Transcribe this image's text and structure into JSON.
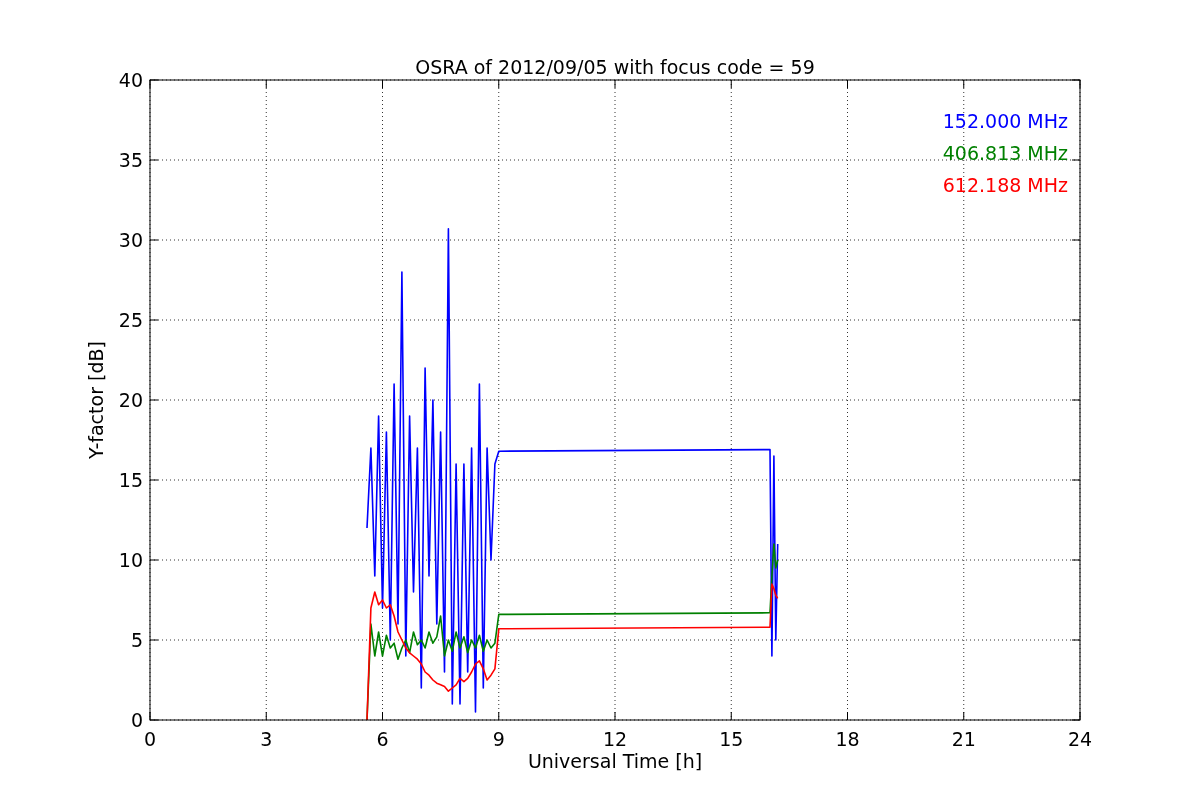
{
  "figure": {
    "chart_data": {
      "type": "line",
      "title": "OSRA of 2012/09/05 with focus code = 59",
      "xlabel": "Universal Time [h]",
      "ylabel": "Y-factor [dB]",
      "grid": true,
      "xlim": [
        0,
        24
      ],
      "ylim": [
        0,
        40
      ],
      "xticks": [
        0,
        3,
        6,
        9,
        12,
        15,
        18,
        21,
        24
      ],
      "yticks": [
        0,
        5,
        10,
        15,
        20,
        25,
        30,
        35,
        40
      ],
      "x": [
        5.6,
        5.7,
        5.8,
        5.9,
        6.0,
        6.1,
        6.2,
        6.3,
        6.4,
        6.5,
        6.6,
        6.7,
        6.8,
        6.9,
        7.0,
        7.1,
        7.2,
        7.3,
        7.4,
        7.5,
        7.6,
        7.7,
        7.8,
        7.9,
        8.0,
        8.1,
        8.2,
        8.3,
        8.4,
        8.5,
        8.6,
        8.7,
        8.8,
        8.9,
        9.0,
        16.0,
        16.05,
        16.1,
        16.15,
        16.2
      ],
      "series": [
        {
          "name": "152.000 MHz",
          "color": "#0000ff",
          "values": [
            12,
            17,
            9,
            19,
            7,
            18,
            5,
            21,
            6,
            28,
            4,
            19,
            8,
            17,
            2,
            22,
            9,
            20,
            6,
            18,
            3,
            30.7,
            1,
            16,
            1,
            16,
            3,
            17,
            0.5,
            21,
            2,
            17,
            10,
            16,
            16.8,
            16.9,
            4,
            16.5,
            5,
            11
          ]
        },
        {
          "name": "406.813 MHz",
          "color": "#008000",
          "values": [
            0,
            6,
            4,
            5.5,
            4,
            5.3,
            4.5,
            4.8,
            3.8,
            4.5,
            5,
            4.2,
            5.5,
            4.7,
            5,
            4.5,
            5.5,
            4.8,
            5.2,
            6.5,
            4,
            5,
            4.3,
            5.5,
            4.5,
            5.2,
            4.2,
            5,
            4.5,
            5.3,
            4.3,
            5,
            4.5,
            4.8,
            6.6,
            6.7,
            9,
            11,
            9.5,
            10
          ]
        },
        {
          "name": "612.188 MHz",
          "color": "#ff0000",
          "values": [
            0,
            7,
            8,
            7.2,
            7.5,
            7,
            7.2,
            6.5,
            5.5,
            5,
            4.5,
            4.2,
            4,
            3.8,
            3.5,
            3,
            2.8,
            2.5,
            2.3,
            2.2,
            2.1,
            1.8,
            2,
            2.2,
            2.6,
            2.4,
            2.6,
            3,
            3.5,
            3.7,
            3.2,
            2.5,
            2.8,
            3.2,
            5.7,
            5.8,
            8.5,
            8.2,
            7.8,
            7.6
          ]
        }
      ]
    }
  }
}
